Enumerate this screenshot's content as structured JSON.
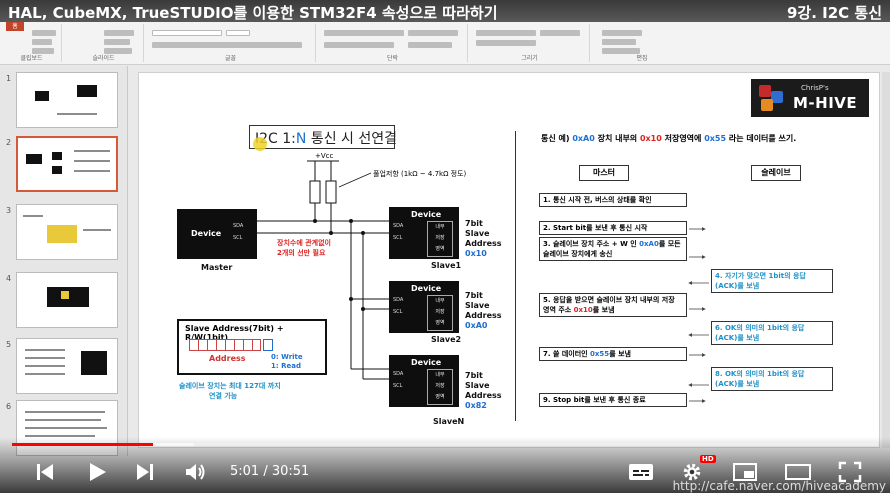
{
  "video": {
    "title": "HAL, CubeMX, TrueSTUDIO를 이용한 STM32F4 속성으로 따라하기",
    "chapter": "9강. I2C 통신",
    "current_time": "5:01",
    "duration": "30:51",
    "time_display": "5:01 / 30:51",
    "played_fraction": 0.163,
    "loaded_fraction": 0.21,
    "hd_badge": "HD",
    "watermark": "http://cafe.naver.com/hiveacademy"
  },
  "ribbon": {
    "home_tab": "홈",
    "groups": [
      "클립보드",
      "슬라이드",
      "글꼴",
      "단락",
      "그리기",
      "편집"
    ]
  },
  "thumbnails": {
    "numbers": [
      "1",
      "2",
      "3",
      "4",
      "5",
      "6"
    ],
    "selected_index": 1
  },
  "slide": {
    "logo_small": "ChrisP's",
    "logo_text": "M-HIVE",
    "title_prefix": "I2C 1",
    "title_colon": ":",
    "title_n": "N",
    "title_rest": " 통신 시 선연결",
    "vcc": "+Vcc",
    "pullup_note": "풀업저항 (1kΩ ~ 4.7kΩ 정도)",
    "line_note_1": "장치수에 관계없이",
    "line_note_2": "2개의 선만 필요",
    "master": {
      "device": "Device",
      "sda": "SDA",
      "scl": "SCL",
      "label": "Master"
    },
    "slaves": [
      {
        "device": "Device",
        "sda": "SDA",
        "scl": "SCL",
        "reg": [
          "내부",
          "저장",
          "영역"
        ],
        "label": "Slave1",
        "bits": "7bit",
        "slave": "Slave",
        "address": "Address",
        "hex": "0x10"
      },
      {
        "device": "Device",
        "sda": "SDA",
        "scl": "SCL",
        "reg": [
          "내부",
          "저장",
          "영역"
        ],
        "label": "Slave2",
        "bits": "7bit",
        "slave": "Slave",
        "address": "Address",
        "hex": "0xA0"
      },
      {
        "device": "Device",
        "sda": "SDA",
        "scl": "SCL",
        "reg": [
          "내부",
          "저장",
          "영역"
        ],
        "label": "SlaveN",
        "bits": "7bit",
        "slave": "Slave",
        "address": "Address",
        "hex": "0x82"
      }
    ],
    "slave_address_box": {
      "title": "Slave Address(7bit) + R/W(1bit)",
      "address": "Address",
      "write": "0: Write",
      "read": "1: Read"
    },
    "slave_limit_1": "슬레이브 장치는 최대 127대 까지",
    "slave_limit_2": "연결 가능",
    "comm": {
      "title_a": "통신 예) ",
      "title_hex1": "0xA0",
      "title_b": " 장치 내부의 ",
      "title_hex2": "0x10",
      "title_c": " 저장영역에 ",
      "title_hex3": "0x55",
      "title_d": " 라는 데이터를 쓰기.",
      "master_header": "마스터",
      "slave_header": "슬레이브",
      "steps": [
        {
          "a": "1. 통신 시작 전, 버스의 상태를 확인",
          "b": "",
          "c": ""
        },
        {
          "a": "2. Start bit를 보낸 후 통신 시작",
          "b": "",
          "c": ""
        },
        {
          "a": "3. 슬레이브 장치 주소 + W 인 ",
          "b": "0xA0",
          "c": "를 모든 슬레이브 장치에게 송신"
        },
        {
          "a": "5. 응답을 받으면 슬레이브 장치 내부의 저장 영역 주소 ",
          "b": "0x10",
          "c": "를 보냄"
        },
        {
          "a": "7. 쓸 데이터인 ",
          "b": "0x55",
          "c": "를 보냄"
        },
        {
          "a": "9. Stop bit를 보낸 후 통신 종료",
          "b": "",
          "c": ""
        }
      ],
      "responses": [
        "4. 자기가 맞으면 1bit의 응답 (ACK)를 보냄",
        "6. OK의 의미의 1bit의 응답 (ACK)를 보냄",
        "8. OK의 의미의 1bit의 응답 (ACK)를 보냄"
      ]
    }
  },
  "colors": {
    "accent_red": "#ff0000",
    "blue": "#1e6fd0",
    "cyan": "#1e90c8",
    "red_text": "#d22222"
  }
}
